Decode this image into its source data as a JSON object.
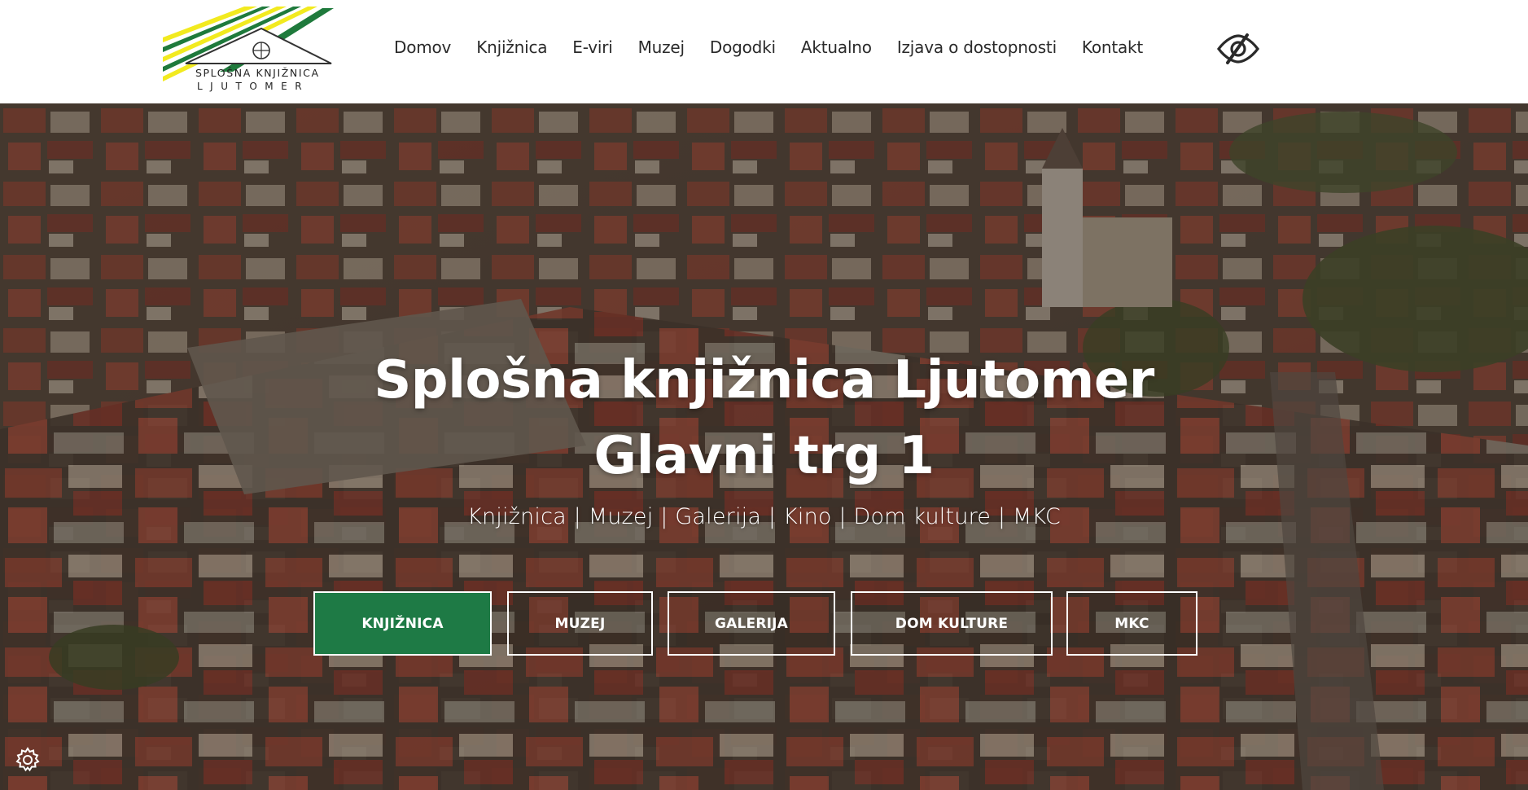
{
  "logo": {
    "line1": "SPLOŠNA KNJIŽNICA",
    "line2": "LJUTOMER",
    "colors": {
      "yellow": "#f2ea1f",
      "green": "#1f7a3c",
      "dark": "#333333"
    }
  },
  "nav": {
    "items": [
      {
        "label": "Domov"
      },
      {
        "label": "Knjižnica"
      },
      {
        "label": "E-viri"
      },
      {
        "label": "Muzej"
      },
      {
        "label": "Dogodki"
      },
      {
        "label": "Aktualno"
      },
      {
        "label": "Izjava o dostopnosti"
      },
      {
        "label": "Kontakt"
      }
    ],
    "accessibility_icon": "eye-slash-icon"
  },
  "hero": {
    "title_line1": "Splošna knjižnica Ljutomer",
    "title_line2": "Glavni trg 1",
    "subtitle": "Knjižnica | Muzej | Galerija | Kino | Dom kulture | MKC",
    "buttons": [
      {
        "label": "KNJIŽNICA",
        "active": true
      },
      {
        "label": "MUZEJ",
        "active": false
      },
      {
        "label": "GALERIJA",
        "active": false
      },
      {
        "label": "DOM KULTURE",
        "active": false
      },
      {
        "label": "MKC",
        "active": false
      }
    ],
    "accent_color": "#1e7a45"
  },
  "settings_icon": "gear-icon"
}
